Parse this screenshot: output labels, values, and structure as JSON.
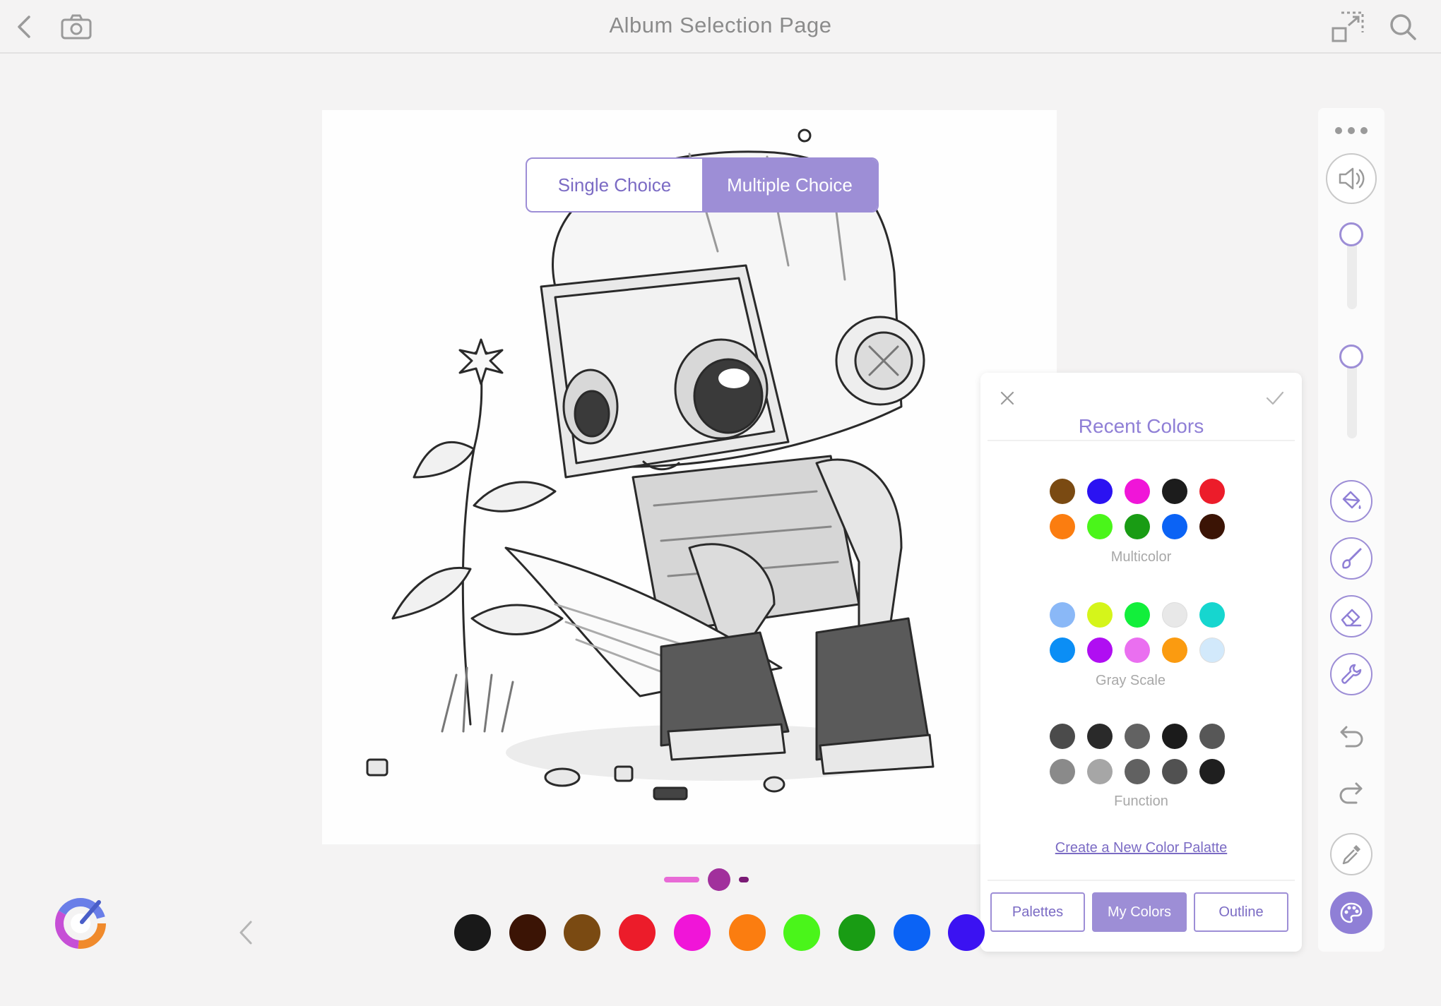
{
  "header": {
    "title": "Album Selection Page"
  },
  "mode_toggle": {
    "options": [
      "Single Choice",
      "Multiple Choice"
    ],
    "selected": "Multiple Choice"
  },
  "toolbar": {
    "more_icon": "more-dots-icon",
    "tools": [
      "volume-icon",
      "paint-bucket-icon",
      "brush-icon",
      "eraser-icon",
      "wrench-icon",
      "undo-icon",
      "redo-icon",
      "eyedropper-icon",
      "palette-icon"
    ],
    "active_tool": "palette-icon"
  },
  "color_panel": {
    "title": "Recent Colors",
    "groups": [
      {
        "label": "Multicolor",
        "colors": [
          "#7a4a12",
          "#2b12f2",
          "#f015d8",
          "#1c1c1c",
          "#ec1c2a",
          "#fb7d10",
          "#4af51a",
          "#199c14",
          "#0b63f5",
          "#3b1405"
        ]
      },
      {
        "label": "Gray Scale",
        "colors": [
          "#8ab8f7",
          "#d5f51a",
          "#12ef3b",
          "#e8e8e8",
          "#16d6cf",
          "#0b8ef5",
          "#b00ef2",
          "#ea6ff0",
          "#fb9b10",
          "#d2e9fb"
        ]
      },
      {
        "label": "Function",
        "colors": [
          "#4b4b4b",
          "#2a2a2a",
          "#626262",
          "#1b1b1b",
          "#575757",
          "#8a8a8a",
          "#a6a6a6",
          "#616161",
          "#515151",
          "#1f1f1f"
        ]
      }
    ],
    "create_link": "Create a New Color Palatte",
    "tabs": [
      "Palettes",
      "My Colors",
      "Outline"
    ],
    "active_tab": "My Colors"
  },
  "bottom_bar": {
    "colors": [
      "#191919",
      "#3b1405",
      "#7a4a12",
      "#ec1c2a",
      "#f015d8",
      "#fb7d10",
      "#4af51a",
      "#199c14",
      "#0b63f5",
      "#3b12f2"
    ]
  }
}
